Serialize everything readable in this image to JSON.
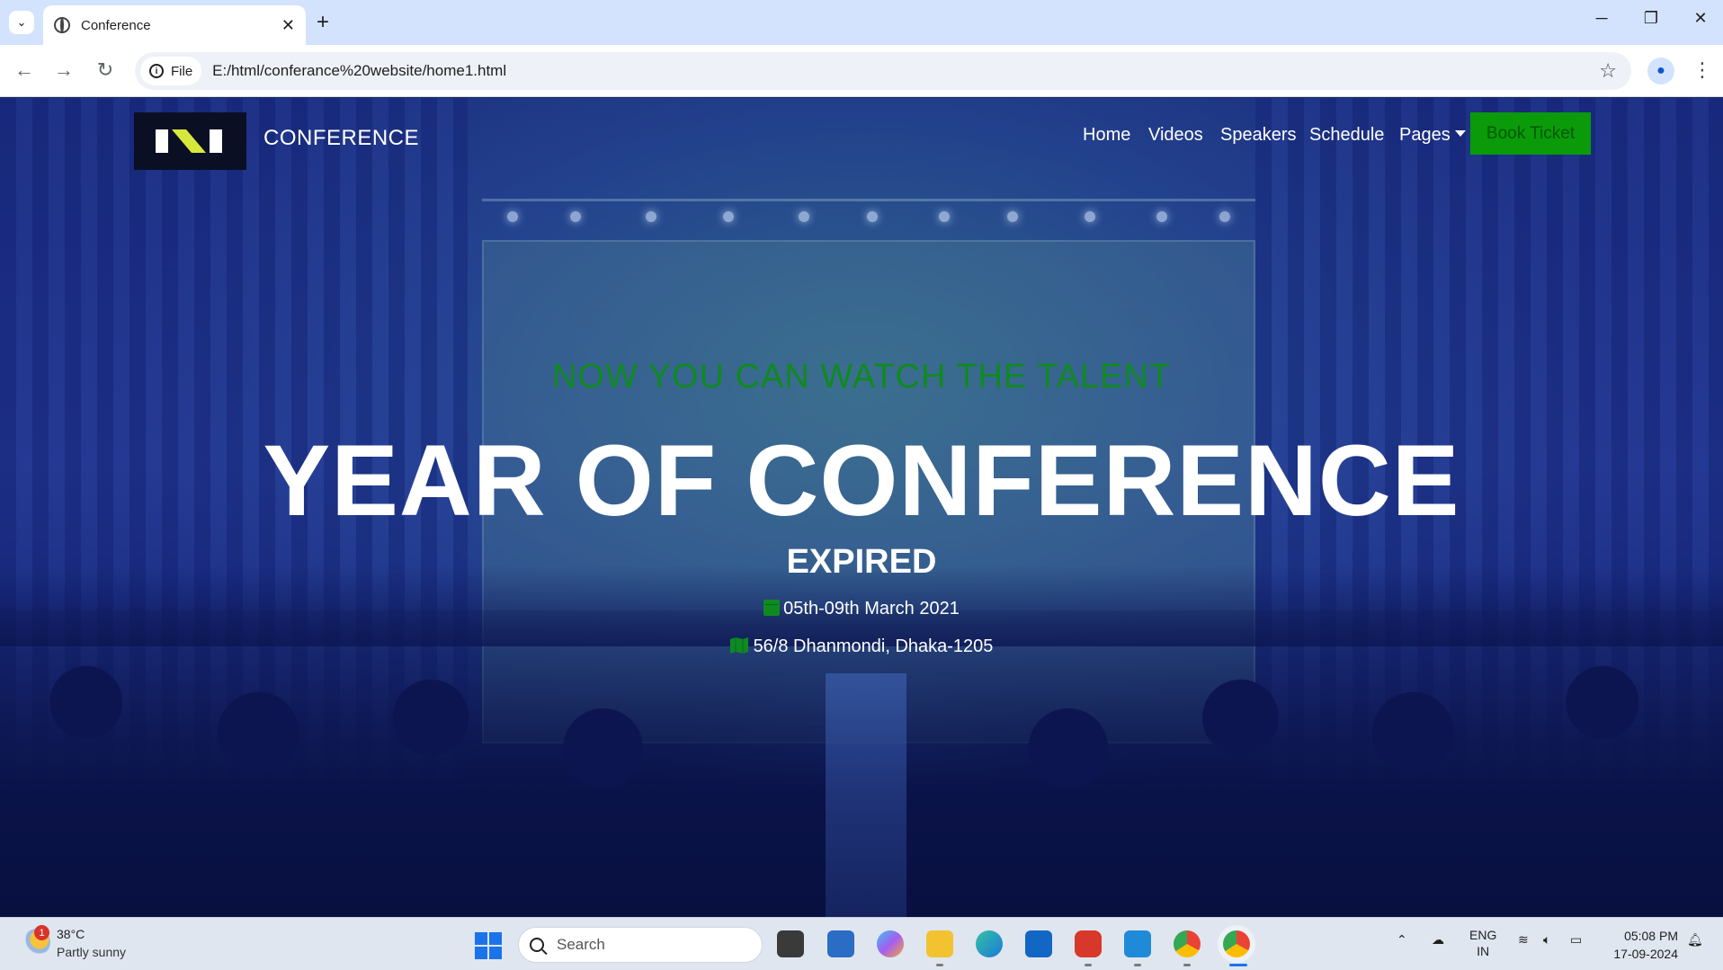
{
  "browser": {
    "tab_title": "Conference",
    "new_tab_label": "+",
    "file_chip_label": "File",
    "url": "E:/html/conferance%20website/home1.html"
  },
  "navbar": {
    "brand": "CONFERENCE",
    "items": [
      {
        "label": "Home"
      },
      {
        "label": "Videos"
      },
      {
        "label": "Speakers"
      },
      {
        "label": "Schedule"
      },
      {
        "label": "Pages"
      }
    ],
    "cta_label": "Book Ticket"
  },
  "hero": {
    "tagline": "NOW YOU CAN WATCH THE TALENT",
    "headline": "YEAR OF CONFERENCE",
    "status": "EXPIRED",
    "date": "05th-09th March 2021",
    "address": "56/8 Dhanmondi, Dhaka-1205"
  },
  "taskbar": {
    "weather_badge": "1",
    "weather_temp": "38°C",
    "weather_desc": "Partly sunny",
    "search_placeholder": "Search",
    "lang_top": "ENG",
    "lang_bottom": "IN",
    "time": "05:08 PM",
    "date": "17-09-2024"
  },
  "colors": {
    "accent_green": "#0a9a0a",
    "tagline_green": "#0f8a1f",
    "hero_blue": "#1b2e7e"
  }
}
